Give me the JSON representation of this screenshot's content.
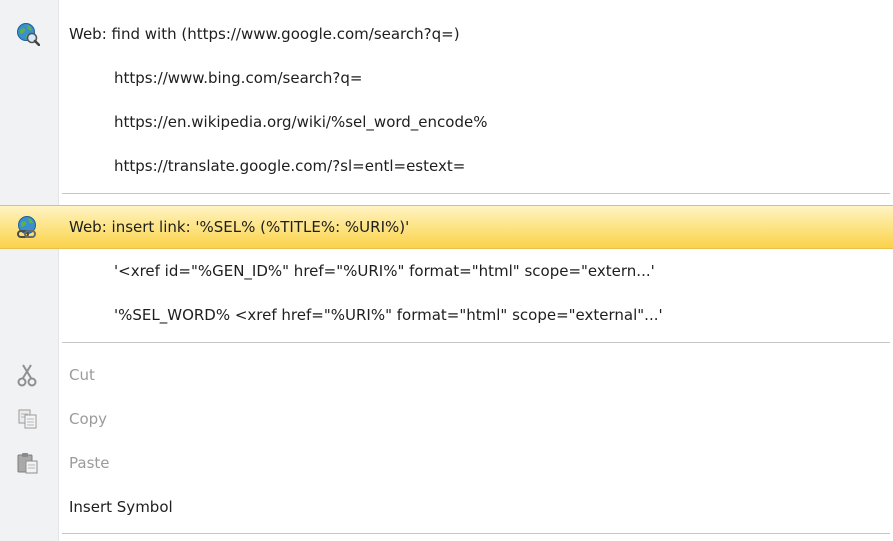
{
  "menu": {
    "web_find": {
      "label": "Web: find with  (https://www.google.com/search?q=)",
      "icon": "globe-search-icon",
      "engines": [
        "https://www.bing.com/search?q=",
        "https://en.wikipedia.org/wiki/%sel_word_encode%",
        "https://translate.google.com/?sl=entl=estext="
      ]
    },
    "web_insert": {
      "label": "Web: insert link: '%SEL% (%TITLE%: %URI%)'",
      "icon": "globe-link-icon",
      "templates": [
        "'<xref id=\"%GEN_ID%\" href=\"%URI%\" format=\"html\" scope=\"extern...'",
        "'%SEL_WORD% <xref href=\"%URI%\" format=\"html\" scope=\"external\"...'"
      ]
    },
    "edit": {
      "cut": "Cut",
      "copy": "Copy",
      "paste": "Paste",
      "insert_symbol": "Insert Symbol"
    }
  },
  "colors": {
    "highlight_top": "#fff3c4",
    "highlight_bottom": "#fbd24a",
    "disabled_text": "#9b9b9b",
    "gutter": "#f1f2f4"
  }
}
